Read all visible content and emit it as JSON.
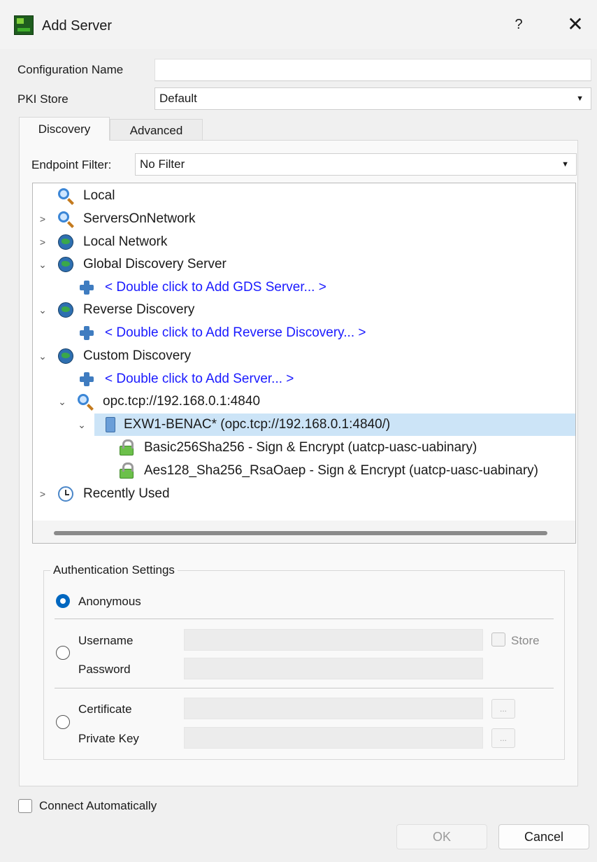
{
  "window": {
    "title": "Add Server",
    "help_glyph": "?",
    "close_glyph": "✕"
  },
  "form": {
    "config_name_label": "Configuration Name",
    "config_name_value": "",
    "pki_store_label": "PKI Store",
    "pki_store_value": "Default"
  },
  "tabs": [
    {
      "label": "Discovery",
      "active": true
    },
    {
      "label": "Advanced",
      "active": false
    }
  ],
  "endpoint_filter": {
    "label": "Endpoint Filter:",
    "value": "No Filter"
  },
  "tree": {
    "items": [
      {
        "text": "Local",
        "icon": "search-icon"
      },
      {
        "text": "ServersOnNetwork",
        "icon": "search-icon",
        "chevron": "collapsed"
      },
      {
        "text": "Local Network",
        "icon": "globe-icon",
        "chevron": "collapsed"
      },
      {
        "text": "Global Discovery Server",
        "icon": "globe-icon",
        "chevron": "expanded"
      },
      {
        "text": "< Double click to Add GDS Server... >",
        "icon": "plus-icon",
        "link": true
      },
      {
        "text": "Reverse Discovery",
        "icon": "globe-icon",
        "chevron": "expanded"
      },
      {
        "text": "< Double click to Add Reverse Discovery... >",
        "icon": "plus-icon",
        "link": true
      },
      {
        "text": "Custom Discovery",
        "icon": "globe-icon",
        "chevron": "expanded"
      },
      {
        "text": "< Double click to Add Server... >",
        "icon": "plus-icon",
        "link": true
      },
      {
        "text": "opc.tcp://192.168.0.1:4840",
        "icon": "search-icon",
        "chevron": "expanded"
      },
      {
        "text": "EXW1-BENAC* (opc.tcp://192.168.0.1:4840/)",
        "icon": "server-icon",
        "chevron": "expanded",
        "selected": true
      },
      {
        "text": "Basic256Sha256 - Sign & Encrypt (uatcp-uasc-uabinary)",
        "icon": "lock-icon"
      },
      {
        "text": "Aes128_Sha256_RsaOaep - Sign & Encrypt (uatcp-uasc-uabinary)",
        "icon": "lock-icon"
      },
      {
        "text": "Recently Used",
        "icon": "clock-icon",
        "chevron": "collapsed"
      }
    ]
  },
  "auth": {
    "group_title": "Authentication Settings",
    "anonymous_label": "Anonymous",
    "username_label": "Username",
    "password_label": "Password",
    "store_label": "Store",
    "certificate_label": "Certificate",
    "private_key_label": "Private Key",
    "browse_label": "...",
    "selected": "anonymous"
  },
  "footer": {
    "connect_auto_label": "Connect Automatically",
    "ok_label": "OK",
    "cancel_label": "Cancel"
  },
  "colors": {
    "accent": "#0067c0",
    "link": "#1a1aff",
    "selection": "#cce4f7"
  }
}
